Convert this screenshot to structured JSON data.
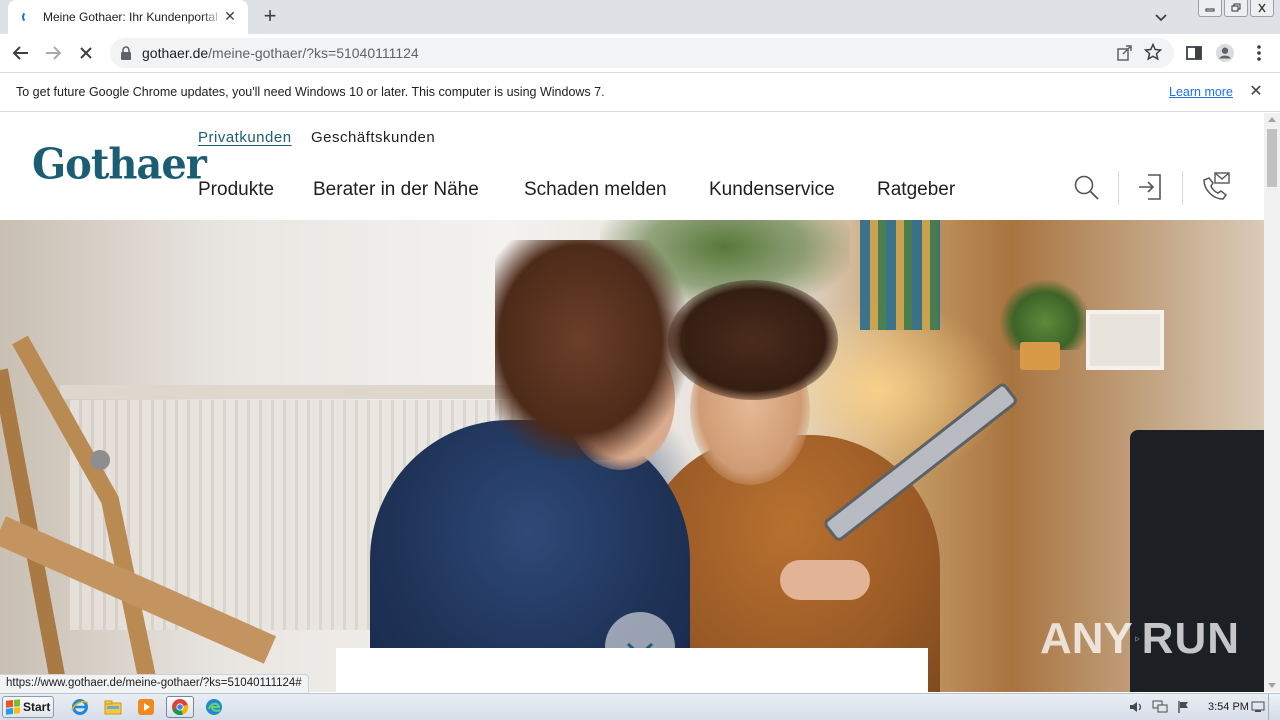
{
  "browser": {
    "tab": {
      "title": "Meine Gothaer: Ihr Kundenportal | G",
      "close_icon": "close-icon"
    },
    "address": {
      "host": "gothaer.de",
      "path": "/meine-gothaer/?ks=51040111124"
    },
    "infobar": {
      "message": "To get future Google Chrome updates, you'll need Windows 10 or later. This computer is using Windows 7.",
      "link": "Learn more"
    },
    "status_url": "https://www.gothaer.de/meine-gothaer/?ks=51040111124#"
  },
  "site": {
    "logo": "Gothaer",
    "segments": [
      {
        "label": "Privatkunden",
        "active": true
      },
      {
        "label": "Geschäftskunden",
        "active": false
      }
    ],
    "nav": [
      "Produkte",
      "Berater in der Nähe",
      "Schaden melden",
      "Kundenservice",
      "Ratgeber"
    ],
    "header_icons": [
      "search-icon",
      "login-icon",
      "contact-icon"
    ],
    "brand_color": "#1b5e73"
  },
  "hero": {
    "watermark": {
      "left": "ANY",
      "right": "RUN"
    }
  },
  "taskbar": {
    "start_label": "Start",
    "pinned": [
      "internet-explorer-icon",
      "file-explorer-icon",
      "media-player-icon",
      "chrome-icon",
      "edge-icon"
    ],
    "clock": "3:54 PM"
  }
}
